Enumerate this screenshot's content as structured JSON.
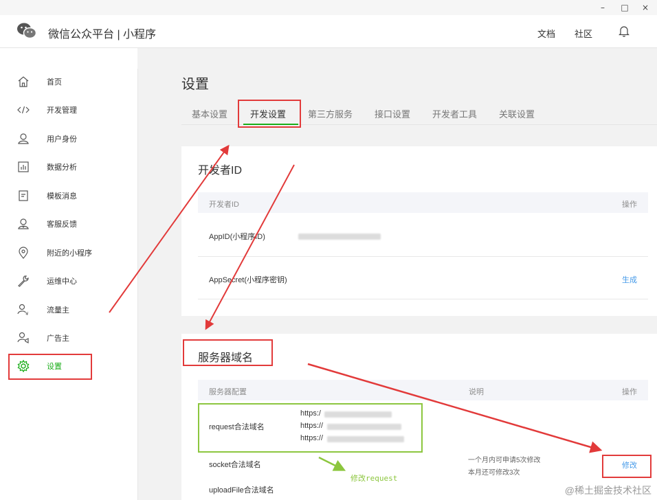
{
  "window": {
    "minimize": "–",
    "maximize": "□",
    "close": "×"
  },
  "header": {
    "brand": "微信公众平台 | 小程序",
    "links": {
      "docs": "文档",
      "community": "社区"
    }
  },
  "sidebar": {
    "items": [
      {
        "label": "首页",
        "icon": "home-icon"
      },
      {
        "label": "开发管理",
        "icon": "code-icon"
      },
      {
        "label": "用户身份",
        "icon": "user-icon"
      },
      {
        "label": "数据分析",
        "icon": "chart-icon"
      },
      {
        "label": "模板消息",
        "icon": "template-icon"
      },
      {
        "label": "客服反馈",
        "icon": "service-icon"
      },
      {
        "label": "附近的小程序",
        "icon": "location-icon"
      },
      {
        "label": "运维中心",
        "icon": "wrench-icon"
      },
      {
        "label": "流量主",
        "icon": "traffic-icon"
      },
      {
        "label": "广告主",
        "icon": "advertiser-icon"
      },
      {
        "label": "设置",
        "icon": "gear-icon",
        "active": true
      }
    ]
  },
  "page": {
    "title": "设置",
    "tabs": [
      "基本设置",
      "开发设置",
      "第三方服务",
      "接口设置",
      "开发者工具",
      "关联设置"
    ],
    "active_tab": "开发设置"
  },
  "developer_id": {
    "title": "开发者ID",
    "columns": {
      "name": "开发者ID",
      "action": "操作"
    },
    "rows": [
      {
        "label": "AppID(小程序ID)"
      },
      {
        "label": "AppSecret(小程序密钥)",
        "action": "生成"
      }
    ]
  },
  "server_domain": {
    "title": "服务器域名",
    "columns": {
      "config": "服务器配置",
      "desc": "说明",
      "action": "操作"
    },
    "rows": [
      {
        "label": "request合法域名",
        "domains": [
          "https:/",
          "https://",
          "https://"
        ]
      },
      {
        "label": "socket合法域名"
      },
      {
        "label": "uploadFile合法域名"
      }
    ],
    "description": {
      "line1": "一个月内可申请5次修改",
      "line2": "本月还可修改3次"
    },
    "action": "修改"
  },
  "annotation": {
    "note": "修改request"
  },
  "watermark": "@稀土掘金技术社区",
  "colors": {
    "accent": "#1aad19",
    "link": "#459ae9",
    "annotation_red": "#e23a3a",
    "annotation_green": "#8cc63e"
  }
}
